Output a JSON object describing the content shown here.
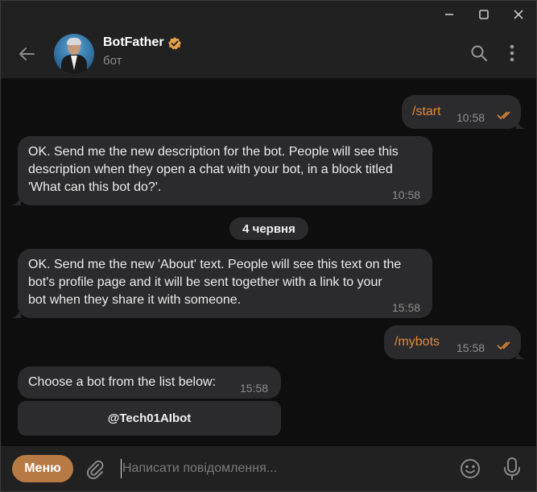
{
  "window": {
    "controls": [
      "minimize-icon",
      "maximize-icon",
      "close-icon"
    ]
  },
  "header": {
    "chat_name": "BotFather",
    "status": "бот",
    "icons": [
      "back-arrow-icon",
      "verified-badge-icon",
      "search-icon",
      "more-vertical-icon"
    ]
  },
  "messages": [
    {
      "direction": "out",
      "text": "/start",
      "time": "10:58",
      "read": true
    },
    {
      "direction": "in",
      "lines": [
        "OK. Send me the new description for the bot. People will see this",
        "description when they open a chat with your bot, in a block titled",
        "'What can this bot do?'."
      ],
      "time": "10:58"
    },
    {
      "type": "date",
      "text": "4 червня"
    },
    {
      "direction": "in",
      "lines": [
        "OK. Send me the new 'About' text. People will see this text on the",
        "bot's profile page and it will be sent together with a link to your",
        "bot when they share it with someone."
      ],
      "time": "15:58"
    },
    {
      "direction": "out",
      "text": "/mybots",
      "time": "15:58",
      "read": true
    },
    {
      "direction": "in",
      "text": "Choose a bot from the list below:",
      "time": "15:58",
      "inline_button": "@Tech01AIbot"
    }
  ],
  "composer": {
    "menu_label": "Меню",
    "placeholder": "Написати повідомлення...",
    "icons": [
      "attach-icon",
      "emoji-icon",
      "microphone-icon"
    ]
  },
  "colors": {
    "background": "#0e0e0e",
    "panel": "#212121",
    "bubble": "#2b2b2d",
    "accent": "#b87a45",
    "command": "#e28a3c",
    "read_ticks": "#e28a3c",
    "verified": "#e7a04a"
  }
}
